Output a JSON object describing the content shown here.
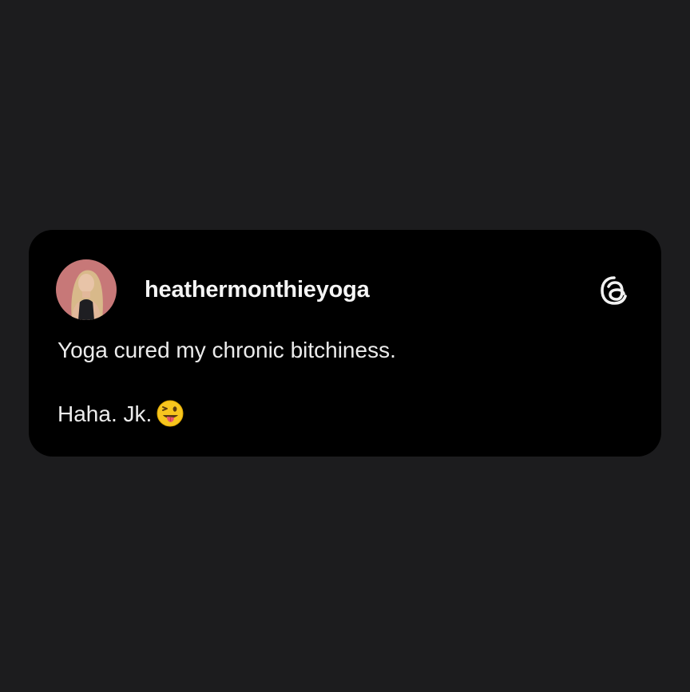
{
  "post": {
    "username": "heathermonthieyoga",
    "text_line_1": "Yoga cured my chronic bitchiness.",
    "text_line_2": "Haha. Jk.",
    "emoji_icon": "winking-face-with-tongue-icon",
    "platform_icon": "threads-logo-icon"
  },
  "colors": {
    "page_background": "#1c1c1e",
    "card_background": "#000000",
    "text": "#ececec",
    "avatar_ring": "#c97979"
  }
}
